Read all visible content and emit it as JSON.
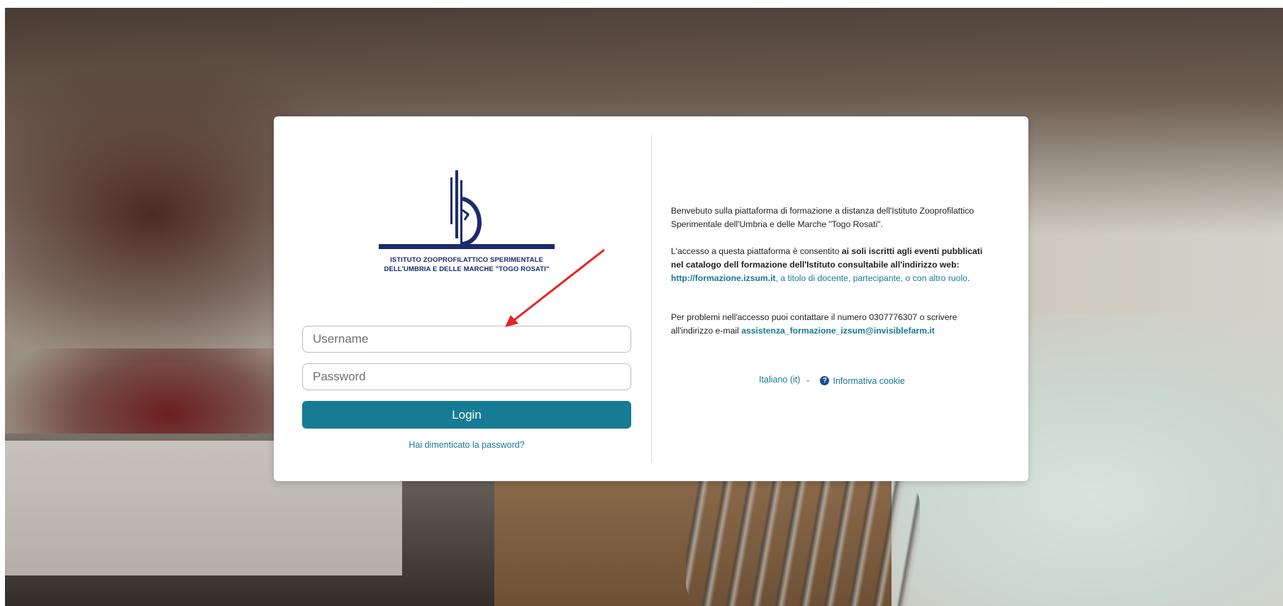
{
  "logo": {
    "caption_line1": "ISTITUTO ZOOPROFILATTICO SPERIMENTALE",
    "caption_line2": "DELL'UMBRIA E DELLE MARCHE \"TOGO ROSATI\""
  },
  "login_form": {
    "username_placeholder": "Username",
    "password_placeholder": "Password",
    "login_label": "Login",
    "forgot_password_label": "Hai dimenticato la password?"
  },
  "info": {
    "welcome": "Benvebuto sulla piattaforma di formazione a distanza dell'Istituto Zooprofilattico Sperimentale dell'Umbria e delle Marche \"Togo Rosati\".",
    "access_intro": "L'accesso a questa piattaforma è consentito ",
    "access_bold": "ai soli iscritti  agli eventi pubblicati nel catalogo dell formazione dell'Istituto consultabile all'indirizzo web: ",
    "access_link": "http://formazione.izsum.it",
    "access_tail": ", a titolo di docente, partecipante, o con altro ruolo",
    "access_period": ".",
    "problems_text": "Per problemi nell'accesso puoi contattare il numero 0307776307 o scrivere all'indirizzo e-mail ",
    "problems_email": "assistenza_formazione_izsum@invisiblefarm.it"
  },
  "footer": {
    "language_label": "Italiano (it)",
    "cookie_label": "Informativa cookie"
  },
  "colors": {
    "accent": "#167b94",
    "logo_navy": "#1d2a6b",
    "annotation_arrow": "#e8231f"
  },
  "icons": {
    "language_chevron": "chevron-down-icon",
    "cookie_help": "question-circle-icon"
  }
}
